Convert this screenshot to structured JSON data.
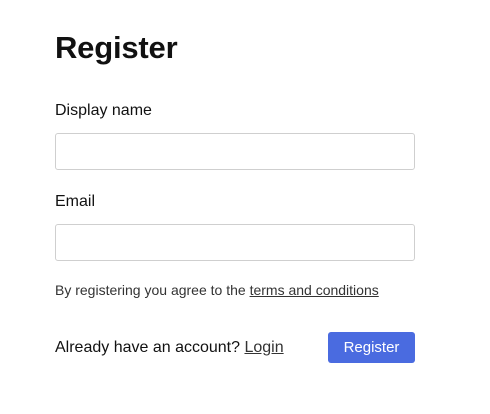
{
  "page": {
    "title": "Register"
  },
  "form": {
    "display_name": {
      "label": "Display name",
      "value": "",
      "placeholder": ""
    },
    "email": {
      "label": "Email",
      "value": "",
      "placeholder": ""
    },
    "terms": {
      "prefix": "By registering you agree to the ",
      "link_text": "terms and conditions"
    },
    "footer": {
      "login_prompt": "Already have an account? ",
      "login_link": "Login",
      "register_button": "Register"
    }
  },
  "colors": {
    "primary_button": "#4a6be0",
    "input_border": "#cfcfcf"
  }
}
